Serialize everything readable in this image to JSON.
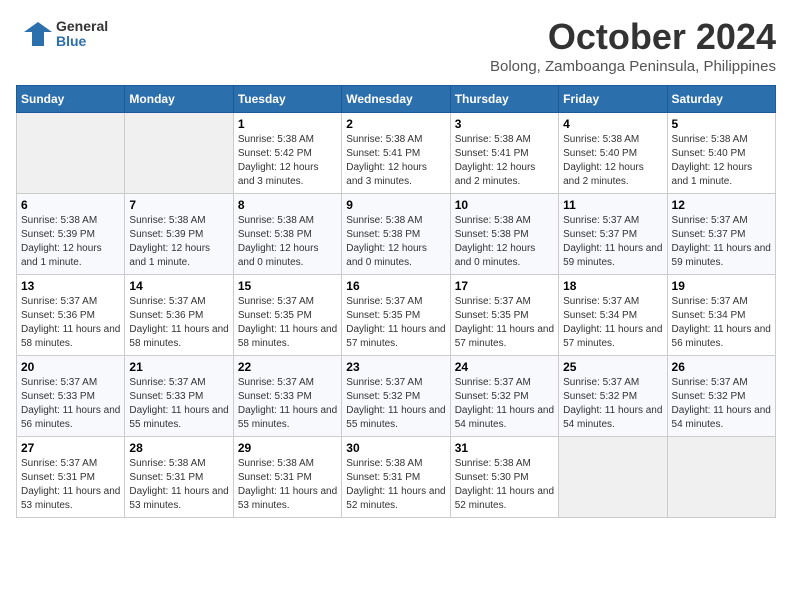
{
  "header": {
    "logo_general": "General",
    "logo_blue": "Blue",
    "month_title": "October 2024",
    "location": "Bolong, Zamboanga Peninsula, Philippines"
  },
  "calendar": {
    "days_of_week": [
      "Sunday",
      "Monday",
      "Tuesday",
      "Wednesday",
      "Thursday",
      "Friday",
      "Saturday"
    ],
    "weeks": [
      [
        {
          "day": "",
          "info": ""
        },
        {
          "day": "",
          "info": ""
        },
        {
          "day": "1",
          "info": "Sunrise: 5:38 AM\nSunset: 5:42 PM\nDaylight: 12 hours and 3 minutes."
        },
        {
          "day": "2",
          "info": "Sunrise: 5:38 AM\nSunset: 5:41 PM\nDaylight: 12 hours and 3 minutes."
        },
        {
          "day": "3",
          "info": "Sunrise: 5:38 AM\nSunset: 5:41 PM\nDaylight: 12 hours and 2 minutes."
        },
        {
          "day": "4",
          "info": "Sunrise: 5:38 AM\nSunset: 5:40 PM\nDaylight: 12 hours and 2 minutes."
        },
        {
          "day": "5",
          "info": "Sunrise: 5:38 AM\nSunset: 5:40 PM\nDaylight: 12 hours and 1 minute."
        }
      ],
      [
        {
          "day": "6",
          "info": "Sunrise: 5:38 AM\nSunset: 5:39 PM\nDaylight: 12 hours and 1 minute."
        },
        {
          "day": "7",
          "info": "Sunrise: 5:38 AM\nSunset: 5:39 PM\nDaylight: 12 hours and 1 minute."
        },
        {
          "day": "8",
          "info": "Sunrise: 5:38 AM\nSunset: 5:38 PM\nDaylight: 12 hours and 0 minutes."
        },
        {
          "day": "9",
          "info": "Sunrise: 5:38 AM\nSunset: 5:38 PM\nDaylight: 12 hours and 0 minutes."
        },
        {
          "day": "10",
          "info": "Sunrise: 5:38 AM\nSunset: 5:38 PM\nDaylight: 12 hours and 0 minutes."
        },
        {
          "day": "11",
          "info": "Sunrise: 5:37 AM\nSunset: 5:37 PM\nDaylight: 11 hours and 59 minutes."
        },
        {
          "day": "12",
          "info": "Sunrise: 5:37 AM\nSunset: 5:37 PM\nDaylight: 11 hours and 59 minutes."
        }
      ],
      [
        {
          "day": "13",
          "info": "Sunrise: 5:37 AM\nSunset: 5:36 PM\nDaylight: 11 hours and 58 minutes."
        },
        {
          "day": "14",
          "info": "Sunrise: 5:37 AM\nSunset: 5:36 PM\nDaylight: 11 hours and 58 minutes."
        },
        {
          "day": "15",
          "info": "Sunrise: 5:37 AM\nSunset: 5:35 PM\nDaylight: 11 hours and 58 minutes."
        },
        {
          "day": "16",
          "info": "Sunrise: 5:37 AM\nSunset: 5:35 PM\nDaylight: 11 hours and 57 minutes."
        },
        {
          "day": "17",
          "info": "Sunrise: 5:37 AM\nSunset: 5:35 PM\nDaylight: 11 hours and 57 minutes."
        },
        {
          "day": "18",
          "info": "Sunrise: 5:37 AM\nSunset: 5:34 PM\nDaylight: 11 hours and 57 minutes."
        },
        {
          "day": "19",
          "info": "Sunrise: 5:37 AM\nSunset: 5:34 PM\nDaylight: 11 hours and 56 minutes."
        }
      ],
      [
        {
          "day": "20",
          "info": "Sunrise: 5:37 AM\nSunset: 5:33 PM\nDaylight: 11 hours and 56 minutes."
        },
        {
          "day": "21",
          "info": "Sunrise: 5:37 AM\nSunset: 5:33 PM\nDaylight: 11 hours and 55 minutes."
        },
        {
          "day": "22",
          "info": "Sunrise: 5:37 AM\nSunset: 5:33 PM\nDaylight: 11 hours and 55 minutes."
        },
        {
          "day": "23",
          "info": "Sunrise: 5:37 AM\nSunset: 5:32 PM\nDaylight: 11 hours and 55 minutes."
        },
        {
          "day": "24",
          "info": "Sunrise: 5:37 AM\nSunset: 5:32 PM\nDaylight: 11 hours and 54 minutes."
        },
        {
          "day": "25",
          "info": "Sunrise: 5:37 AM\nSunset: 5:32 PM\nDaylight: 11 hours and 54 minutes."
        },
        {
          "day": "26",
          "info": "Sunrise: 5:37 AM\nSunset: 5:32 PM\nDaylight: 11 hours and 54 minutes."
        }
      ],
      [
        {
          "day": "27",
          "info": "Sunrise: 5:37 AM\nSunset: 5:31 PM\nDaylight: 11 hours and 53 minutes."
        },
        {
          "day": "28",
          "info": "Sunrise: 5:38 AM\nSunset: 5:31 PM\nDaylight: 11 hours and 53 minutes."
        },
        {
          "day": "29",
          "info": "Sunrise: 5:38 AM\nSunset: 5:31 PM\nDaylight: 11 hours and 53 minutes."
        },
        {
          "day": "30",
          "info": "Sunrise: 5:38 AM\nSunset: 5:31 PM\nDaylight: 11 hours and 52 minutes."
        },
        {
          "day": "31",
          "info": "Sunrise: 5:38 AM\nSunset: 5:30 PM\nDaylight: 11 hours and 52 minutes."
        },
        {
          "day": "",
          "info": ""
        },
        {
          "day": "",
          "info": ""
        }
      ]
    ]
  }
}
